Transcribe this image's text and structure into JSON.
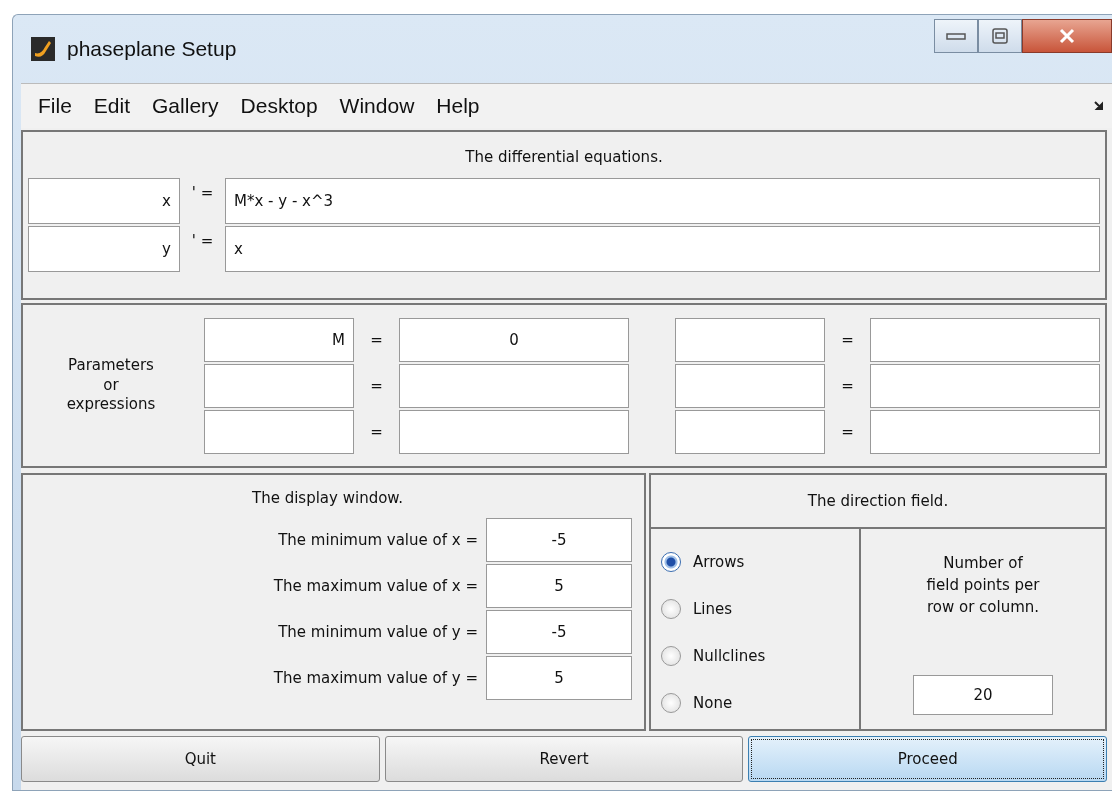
{
  "window": {
    "title": "phaseplane Setup"
  },
  "menu": [
    "File",
    "Edit",
    "Gallery",
    "Desktop",
    "Window",
    "Help"
  ],
  "equations": {
    "title": "The differential equations.",
    "rows": [
      {
        "variable": "x",
        "operator": "' =",
        "expression": "M*x - y - x^3"
      },
      {
        "variable": "y",
        "operator": "' =",
        "expression": "x"
      }
    ]
  },
  "parameters": {
    "label": "Parameters\nor\nexpressions",
    "columns": [
      [
        {
          "name": "M",
          "operator": "=",
          "value": "0"
        },
        {
          "operator": "="
        },
        {
          "operator": "="
        }
      ],
      [
        {
          "operator": "="
        },
        {
          "operator": "="
        },
        {
          "operator": "="
        }
      ]
    ]
  },
  "display_window": {
    "title": "The display window.",
    "rows": [
      {
        "label": "The minimum value of x =",
        "value": "-5"
      },
      {
        "label": "The maximum value of x =",
        "value": "5"
      },
      {
        "label": "The minimum value of y =",
        "value": "-5"
      },
      {
        "label": "The maximum value of y =",
        "value": "5"
      }
    ]
  },
  "direction_field": {
    "title": "The direction field.",
    "options": [
      {
        "label": "Arrows",
        "selected": true
      },
      {
        "label": "Lines",
        "selected": false
      },
      {
        "label": "Nullclines",
        "selected": false
      },
      {
        "label": "None",
        "selected": false
      }
    ],
    "points": {
      "label": "Number of\nfield points per\nrow or column.",
      "value": "20"
    }
  },
  "buttons": [
    {
      "label": "Quit",
      "focused": false
    },
    {
      "label": "Revert",
      "focused": false
    },
    {
      "label": "Proceed",
      "focused": true
    }
  ]
}
